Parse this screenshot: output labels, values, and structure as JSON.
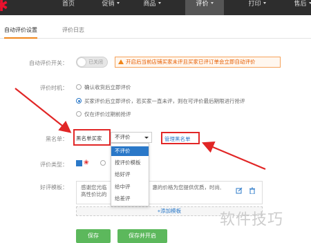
{
  "nav": {
    "items": [
      {
        "label": "首页",
        "caret": false
      },
      {
        "label": "促销",
        "caret": true
      },
      {
        "label": "商品",
        "caret": true
      },
      {
        "label": "评价",
        "caret": true
      },
      {
        "label": "打印",
        "caret": true
      },
      {
        "label": "售后",
        "caret": true
      }
    ],
    "active": "评价"
  },
  "tabs": {
    "auto": "自动评价设置",
    "log": "评价日志"
  },
  "switch": {
    "label": "自动评价开关：",
    "state_text": "已关闭",
    "warning": "开启后当前店铺买家未评且买家已评订单会立即自动评价"
  },
  "timing": {
    "label": "评价时机：",
    "options": [
      {
        "text": "确认收货后立即评价",
        "checked": false
      },
      {
        "text": "买家评价后立即评价，若买家一直未评，则在可评价最后期限进行抢评",
        "checked": true
      },
      {
        "text": "仅在评价过期前抢评",
        "checked": false
      }
    ]
  },
  "blacklist": {
    "label": "黑名单：",
    "value": "黑名单买家",
    "select_value": "不评价",
    "options": [
      "不评价",
      "按评价模板",
      "给好评",
      "给中评",
      "给差评"
    ],
    "selected_option": "不评价",
    "manage_link": "管理黑名单"
  },
  "review_type": {
    "label": "评价类型："
  },
  "template": {
    "label": "好评模板：",
    "text_line1": "感谢您光临",
    "text_line1_tail": "惠的价格为您提供优质，时尚,",
    "text_line2": "高性价比的",
    "add_label": "+添加模板"
  },
  "buttons": {
    "save": "保存",
    "save_open": "保存并开启"
  },
  "watermark": "软件技巧",
  "colors": {
    "nav_bg": "#2d2d2d",
    "accent_red": "#e12626",
    "link_blue": "#2a78c8",
    "button_green": "#5cb85c",
    "warning_orange": "#e55d00"
  }
}
